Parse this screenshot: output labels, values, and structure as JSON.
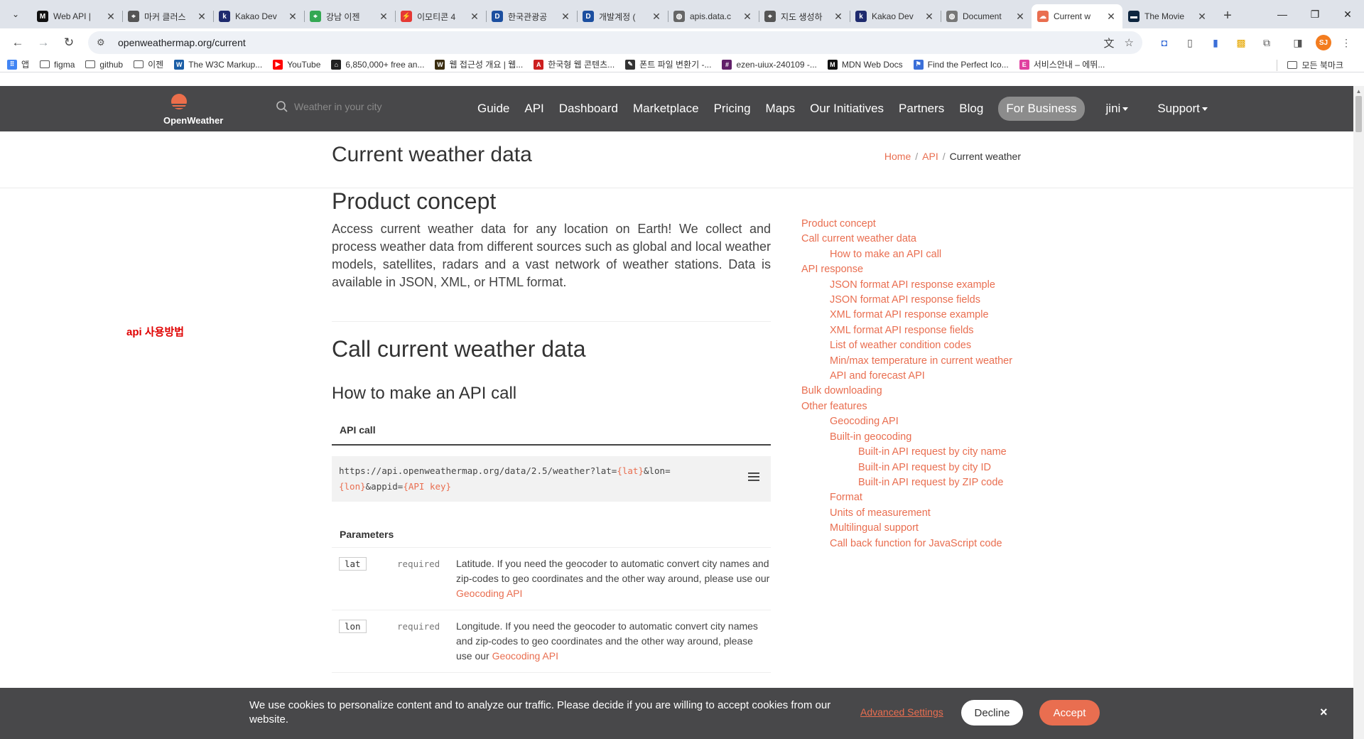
{
  "browser": {
    "tabs": [
      {
        "title": "Web API |",
        "fav_color": "#111111",
        "fav_char": "M"
      },
      {
        "title": "마커 클러스",
        "fav_color": "#555555",
        "fav_char": "⌖"
      },
      {
        "title": "Kakao Dev",
        "fav_color": "#1e2a6e",
        "fav_char": "k"
      },
      {
        "title": "강남 이젠",
        "fav_color": "#34a853",
        "fav_char": "⌖"
      },
      {
        "title": "이모티콘 4",
        "fav_color": "#e53935",
        "fav_char": "⚡"
      },
      {
        "title": "한국관광공",
        "fav_color": "#1c4fa0",
        "fav_char": "D"
      },
      {
        "title": "개발계정 (",
        "fav_color": "#1c4fa0",
        "fav_char": "D"
      },
      {
        "title": "apis.data.c",
        "fav_color": "#666666",
        "fav_char": "◍"
      },
      {
        "title": "지도 생성하",
        "fav_color": "#555555",
        "fav_char": "⌖"
      },
      {
        "title": "Kakao Dev",
        "fav_color": "#1e2a6e",
        "fav_char": "k"
      },
      {
        "title": "Document",
        "fav_color": "#777777",
        "fav_char": "◍"
      },
      {
        "title": "Current w",
        "fav_color": "#e96e50",
        "fav_char": "☁",
        "active": true
      },
      {
        "title": "The Movie",
        "fav_color": "#0d253f",
        "fav_char": "▬"
      }
    ],
    "url": "openweathermap.org/current",
    "bookmarks": [
      {
        "label": "앱",
        "color": "#4285f4",
        "char": "⠿"
      },
      {
        "label": "figma",
        "color": "#666666",
        "char": "▭",
        "folder": true
      },
      {
        "label": "github",
        "color": "#666666",
        "char": "▭",
        "folder": true
      },
      {
        "label": "이젠",
        "color": "#666666",
        "char": "▭",
        "folder": true
      },
      {
        "label": "The W3C Markup...",
        "color": "#1b5ea6",
        "char": "W"
      },
      {
        "label": "YouTube",
        "color": "#ff0000",
        "char": "▶"
      },
      {
        "label": "6,850,000+ free an...",
        "color": "#222222",
        "char": "⌂"
      },
      {
        "label": "웹 접근성 개요 | 웹...",
        "color": "#3a2d10",
        "char": "W"
      },
      {
        "label": "한국형 웹 콘텐츠...",
        "color": "#cc1f1f",
        "char": "A"
      },
      {
        "label": "폰트 파일 변환기 -...",
        "color": "#333333",
        "char": "✎"
      },
      {
        "label": "ezen-uiux-240109 -...",
        "color": "#611f69",
        "char": "#"
      },
      {
        "label": "MDN Web Docs",
        "color": "#111111",
        "char": "M"
      },
      {
        "label": "Find the Perfect Ico...",
        "color": "#3b6fd8",
        "char": "⚑"
      },
      {
        "label": "서비스안내 – 에뛰...",
        "color": "#e040a0",
        "char": "E"
      }
    ],
    "all_bookmarks": "모든 북마크",
    "profile_initials": "SJ"
  },
  "site": {
    "logo_text": "OpenWeather",
    "search_placeholder": "Weather in your city",
    "menu": [
      "Guide",
      "API",
      "Dashboard",
      "Marketplace",
      "Pricing",
      "Maps",
      "Our Initiatives",
      "Partners",
      "Blog"
    ],
    "for_business": "For Business",
    "user": "jini",
    "support": "Support",
    "accent": "#e96e50"
  },
  "page": {
    "title": "Current weather data",
    "breadcrumb": {
      "home": "Home",
      "api": "API",
      "current": "Current weather"
    },
    "product_concept": {
      "heading": "Product concept",
      "text": "Access current weather data for any location on Earth! We collect and process weather data from different sources such as global and local weather models, satellites, radars and a vast network of weather stations. Data is available in JSON, XML, or HTML format."
    },
    "call_heading": "Call current weather data",
    "how_heading": "How to make an API call",
    "api_call_label": "API call",
    "code": {
      "part1": "https://api.openweathermap.org/data/2.5/weather?lat=",
      "lat": "{lat}",
      "part2": "&lon=",
      "lon": "{lon}",
      "part3": "&appid=",
      "key": "{API key}"
    },
    "parameters_label": "Parameters",
    "params": [
      {
        "name": "lat",
        "req": "required",
        "desc": "Latitude. If you need the geocoder to automatic convert city names and zip-codes to geo coordinates and the other way around, please use our ",
        "link": "Geocoding API"
      },
      {
        "name": "lon",
        "req": "required",
        "desc": "Longitude. If you need the geocoder to automatic convert city names and zip-codes to geo coordinates and the other way around, please use our ",
        "link": "Geocoding API"
      }
    ]
  },
  "toc": [
    {
      "label": "Product concept",
      "level": 1
    },
    {
      "label": "Call current weather data",
      "level": 1
    },
    {
      "label": "How to make an API call",
      "level": 2
    },
    {
      "label": "API response",
      "level": 1
    },
    {
      "label": "JSON format API response example",
      "level": 2
    },
    {
      "label": "JSON format API response fields",
      "level": 2
    },
    {
      "label": "XML format API response example",
      "level": 2
    },
    {
      "label": "XML format API response fields",
      "level": 2
    },
    {
      "label": "List of weather condition codes",
      "level": 2
    },
    {
      "label": "Min/max temperature in current weather",
      "level": 2
    },
    {
      "label": "API and forecast API",
      "level": 2
    },
    {
      "label": "Bulk downloading",
      "level": 1
    },
    {
      "label": "Other features",
      "level": 1
    },
    {
      "label": "Geocoding API",
      "level": 2
    },
    {
      "label": "Built-in geocoding",
      "level": 2
    },
    {
      "label": "Built-in API request by city name",
      "level": 3
    },
    {
      "label": "Built-in API request by city ID",
      "level": 3
    },
    {
      "label": "Built-in API request by ZIP code",
      "level": 3
    },
    {
      "label": "Format",
      "level": 2
    },
    {
      "label": "Units of measurement",
      "level": 2
    },
    {
      "label": "Multilingual support",
      "level": 2
    },
    {
      "label": "Call back function for JavaScript code",
      "level": 2
    }
  ],
  "annotation": "api 사용방법",
  "cookie": {
    "message": "We use cookies to personalize content and to analyze our traffic. Please decide if you are willing to accept cookies from our website.",
    "advanced": "Advanced Settings",
    "decline": "Decline",
    "accept": "Accept",
    "close": "×"
  }
}
